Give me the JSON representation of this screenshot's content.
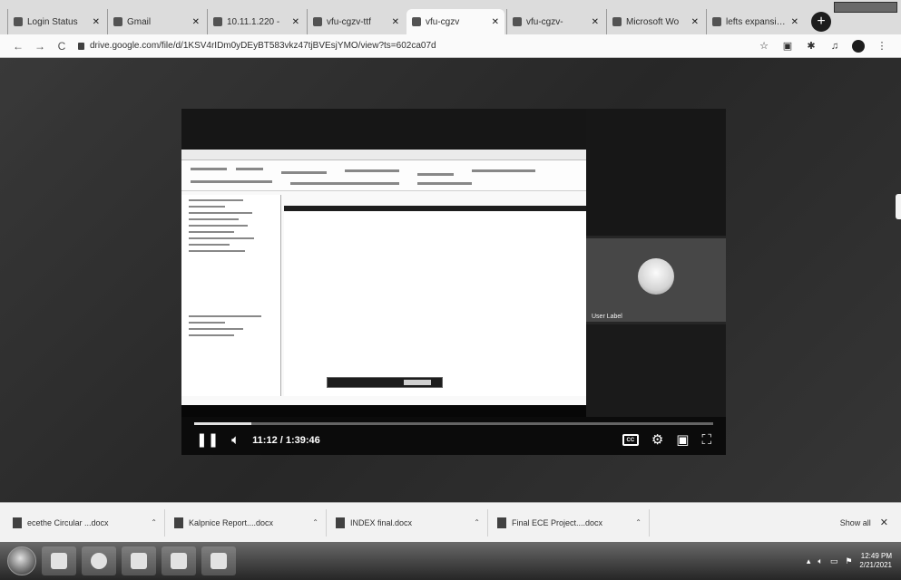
{
  "browser": {
    "tabs": [
      {
        "title": "Login Status",
        "active": false
      },
      {
        "title": "Gmail",
        "active": false
      },
      {
        "title": "10.11.1.220 -",
        "active": false
      },
      {
        "title": "vfu-cgzv-ttf",
        "active": false
      },
      {
        "title": "vfu-cgzv",
        "active": true
      },
      {
        "title": "vfu-cgzv-",
        "active": false
      },
      {
        "title": "Microsoft Wo",
        "active": false
      },
      {
        "title": "lefts expansion",
        "active": false
      }
    ],
    "url": "drive.google.com/file/d/1KSV4rIDm0yDEyBT583vkz47tjBVEsjYMO/view?ts=602ca07d"
  },
  "player": {
    "time": "11:12 / 1:39:46",
    "progress": 0.11,
    "participant_name": "User Label",
    "cc_label": "CC"
  },
  "downloads": {
    "items": [
      {
        "name": "ecethe Circular ...docx"
      },
      {
        "name": "Kalpnice Report....docx"
      },
      {
        "name": "INDEX final.docx"
      },
      {
        "name": "Final ECE Project....docx"
      }
    ],
    "show_all": "Show all"
  },
  "taskbar": {
    "clock_time": "12:49 PM",
    "clock_date": "2/21/2021"
  }
}
